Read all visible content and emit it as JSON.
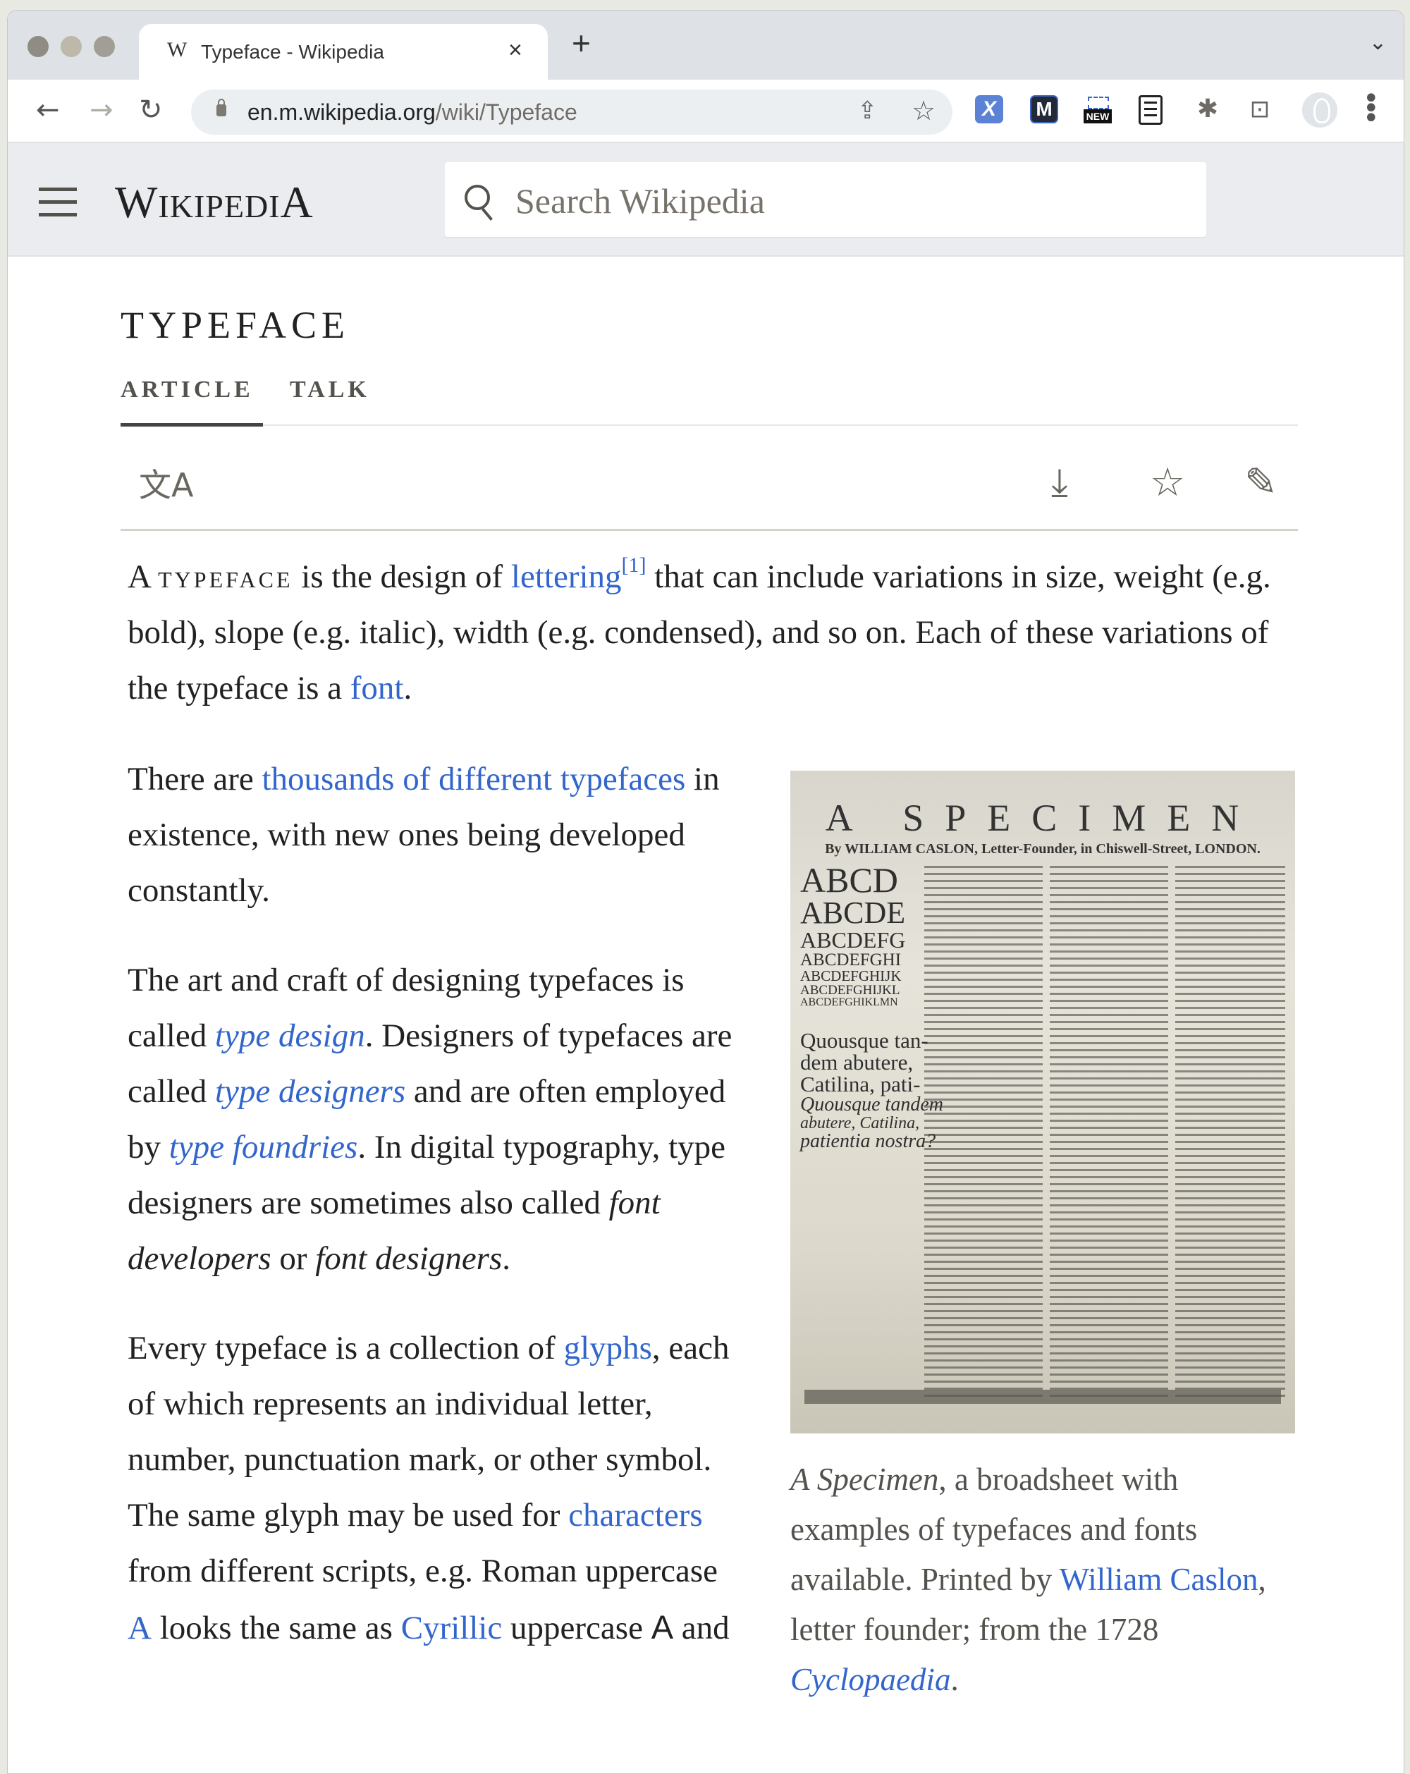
{
  "browser": {
    "tab": {
      "favicon": "W",
      "title": "Typeface - Wikipedia",
      "close": "×"
    },
    "new_tab": "+",
    "tab_list": "⌄",
    "nav": {
      "back": "←",
      "forward": "→",
      "reload": "↻"
    },
    "url": {
      "host": "en.m.wikipedia.org",
      "path": "/wiki/Typeface"
    },
    "omnibox_icons": {
      "share": "⇪",
      "bookmark": "☆"
    },
    "extensions": [
      {
        "name": "x-extension",
        "glyph": "X"
      },
      {
        "name": "m-extension",
        "glyph": "M"
      },
      {
        "name": "new-extension",
        "glyph": "NEW"
      },
      {
        "name": "reader-extension",
        "glyph": ""
      },
      {
        "name": "extensions-puzzle",
        "glyph": "✱"
      },
      {
        "name": "cast",
        "glyph": "⊡"
      }
    ],
    "menu": "⋮"
  },
  "wiki": {
    "logo_first": "W",
    "logo_middle": "IKIPEDI",
    "logo_last": "A",
    "search_placeholder": "Search Wikipedia"
  },
  "page": {
    "title": "TYPEFACE",
    "tabs": [
      {
        "label": "ARTICLE",
        "active": true
      },
      {
        "label": "TALK",
        "active": false
      }
    ],
    "actions": {
      "language": "文A",
      "download": "⤓",
      "watch": "☆",
      "edit": "✎"
    }
  },
  "article": {
    "p1": {
      "t1": "A ",
      "term": "typeface",
      "t2": " is the design of ",
      "link1": "lettering",
      "ref": "[1]",
      "t3": " that can include variations in size, weight (e.g. bold), slope (e.g. italic), width (e.g. condensed), and so on. Each of these variations of the typeface is a ",
      "link2": "font",
      "t4": "."
    },
    "p2": {
      "t1": "There are ",
      "link1": "thousands of different typefaces",
      "t2": " in existence, with new ones being developed constantly."
    },
    "p3": {
      "t1": "The art and craft of designing typefaces is called ",
      "link1": "type design",
      "t2": ". Designers of typefaces are called ",
      "link2": "type designers",
      "t3": " and are often employed by ",
      "link3": "type foundries",
      "t4": ". In digital typography, type designers are sometimes also called ",
      "em1": "font developers",
      "t5": " or ",
      "em2": "font designers",
      "t6": "."
    },
    "p4": {
      "t1": "Every typeface is a collection of ",
      "link1": "glyphs",
      "t2": ", each of which represents an individual letter, number, punctuation mark, or other symbol. The same glyph may be used for ",
      "link2": "characters",
      "t3": " from different scripts, e.g. Roman uppercase ",
      "link3": "A",
      "t4": " looks the same as ",
      "link4": "Cyrillic",
      "t5": " uppercase ",
      "glyph": "А",
      "t6": " and"
    },
    "figure": {
      "image": {
        "title": "A SPECIMEN",
        "subtitle": "By WILLIAM CASLON, Letter-Founder, in Chiswell-Street, LONDON.",
        "big_lines": [
          "ABCD",
          "ABCDE",
          "ABCDEFG",
          "ABCDEFGHI",
          "ABCDEFGHIJK",
          "ABCDEFGHIJKL",
          "ABCDEFGHIKLMN"
        ],
        "sample_lines": [
          "Quousque tan-",
          "dem abutere,",
          "Catilina, pati-"
        ],
        "sample_italic": [
          "Quousque tandem",
          "abutere, Catilina,",
          "patientia nostra?"
        ]
      },
      "caption": {
        "em": "A Specimen",
        "t1": ", a broadsheet with examples of typefaces and fonts available. Printed by ",
        "link1": "William Caslon",
        "t2": ", letter founder; from the 1728 ",
        "link2": "Cyclopaedia",
        "t3": "."
      }
    }
  },
  "colors": {
    "link": "#3366cc",
    "text": "#222222",
    "header_bg": "#eaecf0"
  }
}
